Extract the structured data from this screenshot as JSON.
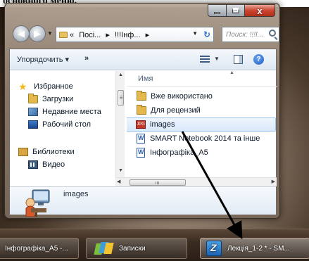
{
  "top_text": "основного меню.",
  "window": {
    "controls": {
      "minimize": "–",
      "maximize": "□",
      "close": "x"
    },
    "address": {
      "crumbs": [
        "«",
        "Посі...",
        "▸",
        "!!!Інф...",
        "▸"
      ],
      "search_placeholder": "Поиск: !!!I..."
    },
    "toolbar": {
      "organize": "Упорядочить ▾",
      "more": "»"
    },
    "nav": {
      "items": [
        {
          "label": "Избранное",
          "icon": "star-icon"
        },
        {
          "label": "Загрузки",
          "icon": "downloads-folder-icon"
        },
        {
          "label": "Недавние места",
          "icon": "recent-places-icon"
        },
        {
          "label": "Рабочий стол",
          "icon": "desktop-icon"
        },
        {
          "label": "Библиотеки",
          "icon": "libraries-icon"
        },
        {
          "label": "Видео",
          "icon": "video-library-icon"
        }
      ]
    },
    "file_list": {
      "column_name": "Имя",
      "items": [
        {
          "label": "Вже використано",
          "icon": "folder-icon"
        },
        {
          "label": "Для рецензий",
          "icon": "folder-icon"
        },
        {
          "label": "images",
          "icon": "image-file-icon",
          "selected": true
        },
        {
          "label": "SMART Notebook 2014 та інше",
          "icon": "word-doc-icon"
        },
        {
          "label": "Інфографіка_А5",
          "icon": "word-doc-icon"
        }
      ]
    },
    "details": {
      "name": "images"
    }
  },
  "taskbar": {
    "items": [
      {
        "label": "Інфографіка_А5 -...",
        "icon": "word-doc-icon"
      },
      {
        "label": "Записки",
        "icon": "sticky-notes-icon"
      },
      {
        "label": "Лекція_1-2 * - SM...",
        "icon": "smart-notebook-icon"
      }
    ]
  }
}
